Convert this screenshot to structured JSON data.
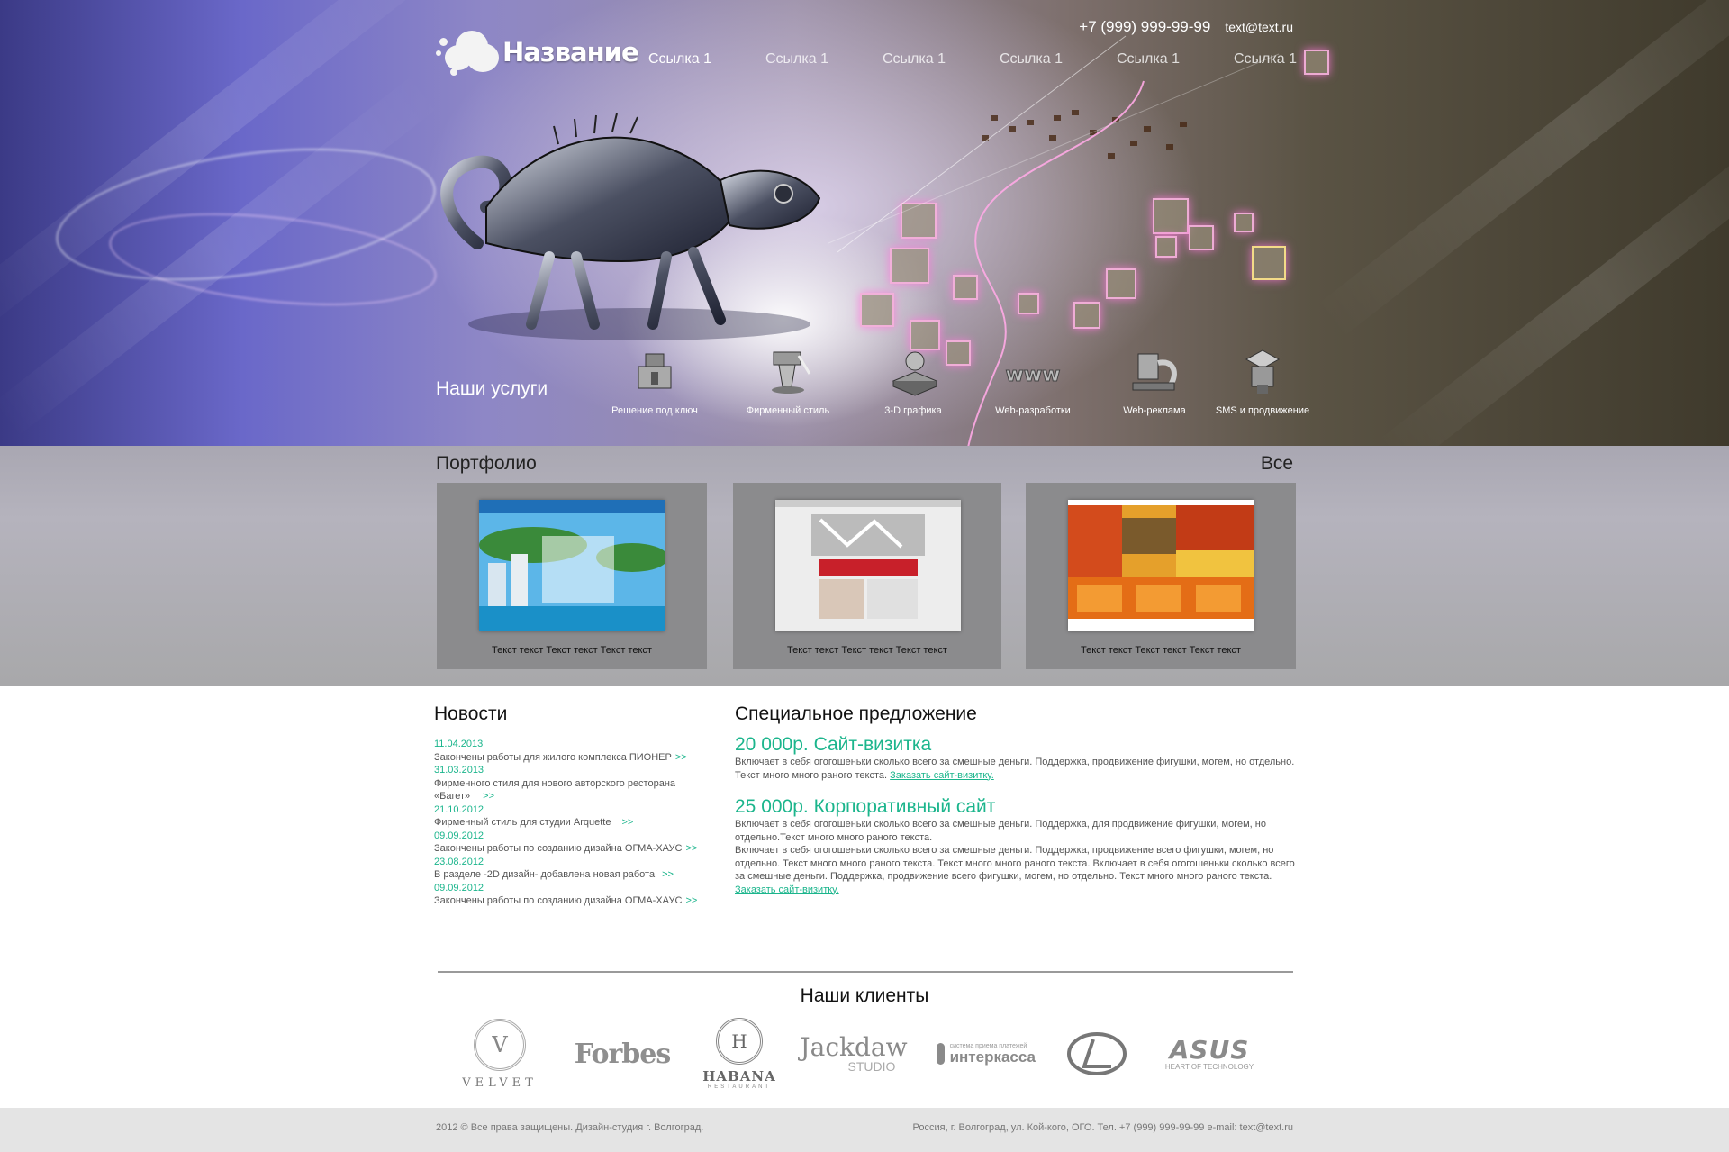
{
  "header": {
    "logo_text": "Название",
    "phone": "+7 (999) 999-99-99",
    "email": "text@text.ru",
    "nav": [
      "Ссылка 1",
      "Ссылка 1",
      "Ссылка 1",
      "Ссылка 1",
      "Ссылка 1",
      "Ссылка 1"
    ]
  },
  "services": {
    "title": "Наши услуги",
    "items": [
      {
        "label": "Решение под ключ",
        "icon": "turnkey-icon"
      },
      {
        "label": "Фирменный стиль",
        "icon": "corporate-style-icon"
      },
      {
        "label": "3-D графика",
        "icon": "3d-graphics-icon"
      },
      {
        "label": "Web-разработки",
        "icon": "www-icon"
      },
      {
        "label": "Web-реклама",
        "icon": "web-ads-icon"
      },
      {
        "label": "SMS и продвижение",
        "icon": "sms-icon"
      }
    ]
  },
  "portfolio": {
    "title": "Портфолио",
    "all_link": "Все",
    "items": [
      {
        "caption": "Текст текст Текст текст Текст текст"
      },
      {
        "caption": "Текст текст Текст текст Текст текст"
      },
      {
        "caption": "Текст текст Текст текст Текст текст"
      }
    ]
  },
  "news": {
    "title": "Новости",
    "more": ">>",
    "items": [
      {
        "date": "11.04.2013",
        "text": "Закончены работы для жилого комплекса ПИОНЕР"
      },
      {
        "date": "31.03.2013",
        "text": "Фирменного стиля для нового авторского ресторана «Багет»"
      },
      {
        "date": "21.10.2012",
        "text": "Фирменный стиль для студии Arquette"
      },
      {
        "date": "09.09.2012",
        "text": "Закончены работы по созданию дизайна ОГМА-ХАУС"
      },
      {
        "date": "23.08.2012",
        "text": "В разделе -2D дизайн- добавлена новая работа"
      },
      {
        "date": "09.09.2012",
        "text": "Закончены работы по созданию дизайна ОГМА-ХАУС"
      }
    ]
  },
  "special": {
    "title": "Специальное предложение",
    "offers": [
      {
        "price": "20 000р. Сайт-визитка",
        "desc": "Включает в себя огогошеньки сколько всего за смешные деньги. Поддержка, продвижение фигушки, могем, но отдельно. Текст много много раного текста.",
        "link": "Заказать сайт-визитку."
      },
      {
        "price": "25 000р. Корпоративный сайт",
        "desc": "Включает в себя огогошеньки сколько всего за смешные деньги. Поддержка, для продвижение фигушки, могем, но отдельно.Текст много много раного текста.",
        "desc2": "Включает в себя огогошеньки сколько всего за смешные деньги. Поддержка, продвижение всего фигушки, могем, но отдельно. Текст много много раного текста. Текст много много раного текста. Включает в себя огогошеньки сколько всего за смешные деньги. Поддержка, продвижение всего фигушки, могем, но отдельно. Текст много много раного текста.",
        "link": "Заказать сайт-визитку."
      }
    ]
  },
  "clients": {
    "title": "Наши клиенты",
    "items": [
      {
        "name": "VELVET",
        "mark": "V"
      },
      {
        "name": "Forbes"
      },
      {
        "name": "HABANA",
        "mark": "H",
        "sub": "RESTAURANT"
      },
      {
        "name": "Jackdaw",
        "sub": "STUDIO"
      },
      {
        "name": "интеркасса",
        "sub": "система приема платежей"
      },
      {
        "name": "Lexus"
      },
      {
        "name": "ASUS",
        "sub": "HEART OF TECHNOLOGY"
      }
    ]
  },
  "footer": {
    "left": "2012 © Все права защищены. Дизайн-студия   г. Волгоград.",
    "right": "Россия, г. Волгоград, ул. Кой-кого, ОГО. Тел. +7 (999) 999-99-99 e-mail: text@text.ru"
  }
}
